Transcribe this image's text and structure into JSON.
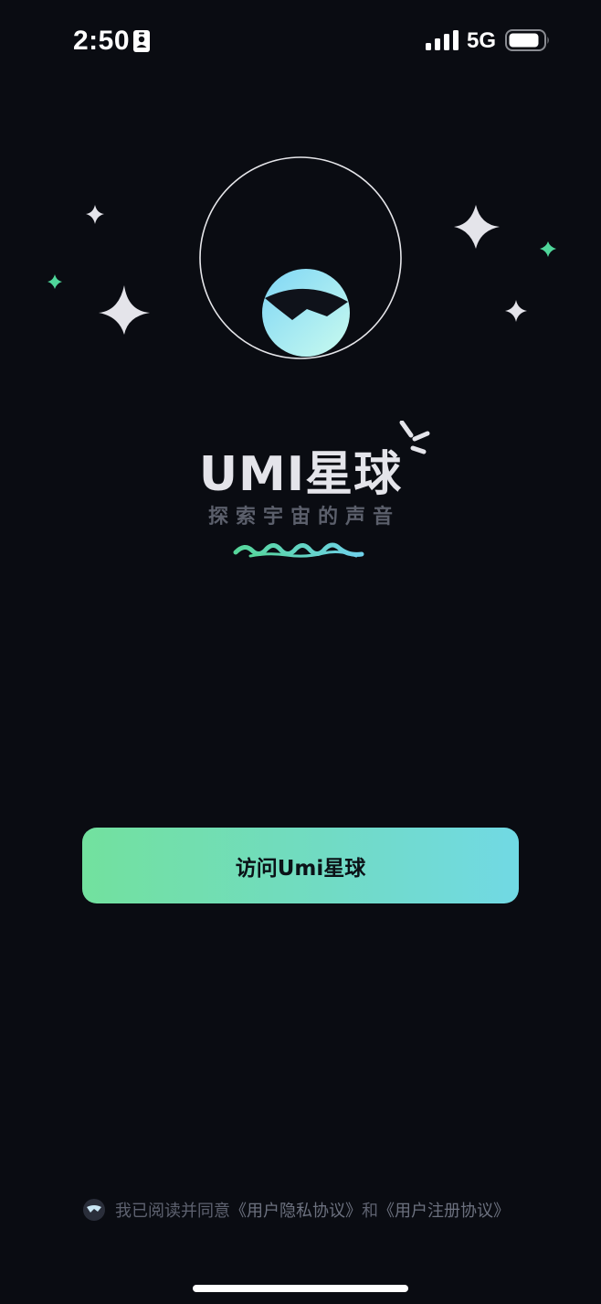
{
  "status_bar": {
    "time": "2:50",
    "network": "5G",
    "icons": [
      "id-card-icon",
      "signal-icon",
      "battery-icon"
    ]
  },
  "brand": {
    "title": "UMI星球",
    "tagline": "探索宇宙的声音"
  },
  "cta": {
    "label": "访问Umi星球"
  },
  "agreement": {
    "prefix": "我已阅读并同意",
    "privacy_link": "《用户隐私协议》",
    "conjunction": "和",
    "register_link": "《用户注册协议》"
  },
  "colors": {
    "background": "#0a0c12",
    "accent_green": "#72e19e",
    "accent_cyan": "#71d9e4",
    "text_muted": "#5e6270"
  }
}
